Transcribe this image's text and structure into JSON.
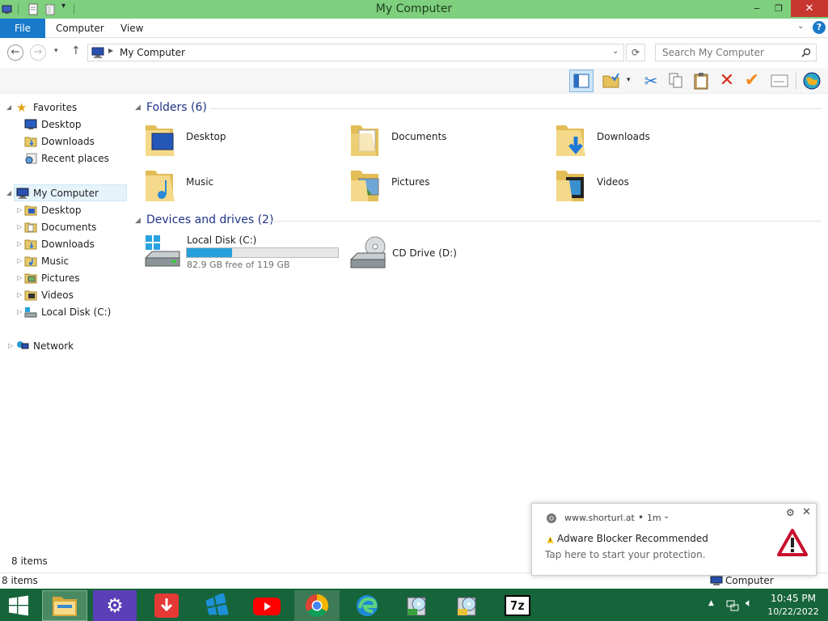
{
  "window": {
    "title": "My Computer"
  },
  "ribbon": {
    "tabs": [
      {
        "label": "File"
      },
      {
        "label": "Computer"
      },
      {
        "label": "View"
      }
    ]
  },
  "address": {
    "path": "My Computer",
    "search_placeholder": "Search My Computer"
  },
  "sidebar": {
    "favorites": {
      "label": "Favorites",
      "items": [
        {
          "label": "Desktop"
        },
        {
          "label": "Downloads"
        },
        {
          "label": "Recent places"
        }
      ]
    },
    "computer": {
      "label": "My Computer",
      "items": [
        {
          "label": "Desktop"
        },
        {
          "label": "Documents"
        },
        {
          "label": "Downloads"
        },
        {
          "label": "Music"
        },
        {
          "label": "Pictures"
        },
        {
          "label": "Videos"
        },
        {
          "label": "Local Disk (C:)"
        }
      ]
    },
    "network": {
      "label": "Network"
    }
  },
  "content": {
    "folders_header": "Folders (6)",
    "folders": [
      {
        "label": "Desktop"
      },
      {
        "label": "Documents"
      },
      {
        "label": "Downloads"
      },
      {
        "label": "Music"
      },
      {
        "label": "Pictures"
      },
      {
        "label": "Videos"
      }
    ],
    "drives_header": "Devices and drives (2)",
    "drives": [
      {
        "label": "Local Disk (C:)",
        "free_text": "82.9 GB free of 119 GB",
        "used_fraction": 0.3
      },
      {
        "label": "CD Drive (D:)"
      }
    ]
  },
  "status": {
    "items_count": "8 items",
    "items_count_bottom": "8 items",
    "location": "Computer"
  },
  "notification": {
    "source": "www.shorturl.at",
    "time": "1m",
    "title": "Adware Blocker Recommended",
    "body": "Tap here to start your protection."
  },
  "taskbar": {
    "time": "10:45 PM",
    "date": "10/22/2022",
    "seven_zip_label": "7z"
  },
  "colors": {
    "titlebar": "#7ecf7e",
    "file_tab": "#1979ca",
    "taskbar": "#16643a",
    "header_text": "#1e3287",
    "progress": "#26a0da"
  }
}
